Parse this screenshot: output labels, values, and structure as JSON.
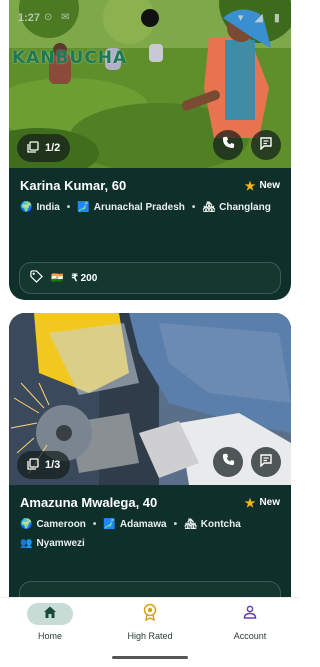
{
  "status_bar": {
    "time": "1:27",
    "left_icons": "⊙ ✉",
    "right_icons": "▾ ◢ ▮"
  },
  "app": {
    "brand": "KANBUCHA"
  },
  "cards": [
    {
      "photo_counter": "1/2",
      "name_age": "Karina Kumar, 60",
      "new_label": "New",
      "country": "India",
      "state": "Arunachal Pradesh",
      "town": "Changlang",
      "flag": "🇮🇳",
      "price": "₹ 200",
      "photo_colors": [
        "#5f8f2b",
        "#3c6b1d",
        "#93b84a"
      ]
    },
    {
      "photo_counter": "1/3",
      "name_age": "Amazuna Mwalega, 40",
      "new_label": "New",
      "country": "Cameroon",
      "state": "Adamawa",
      "town": "Kontcha",
      "ethnicity": "Nyamwezi",
      "photo_colors": [
        "#3a4a5c",
        "#6b8bb3",
        "#f2c81e"
      ]
    }
  ],
  "bottom_nav": [
    {
      "label": "Home",
      "icon": "home-icon",
      "active": true
    },
    {
      "label": "High Rated",
      "icon": "medal-icon",
      "active": false
    },
    {
      "label": "Account",
      "icon": "person-icon",
      "active": false
    }
  ],
  "colors": {
    "card_bg": "#0f2f2a",
    "accent_green": "#1d7a54",
    "star": "#f2b418",
    "nav_active_pill": "#c7dcd4",
    "rated_icon": "#d4a017",
    "account_icon": "#6a3fb5"
  }
}
